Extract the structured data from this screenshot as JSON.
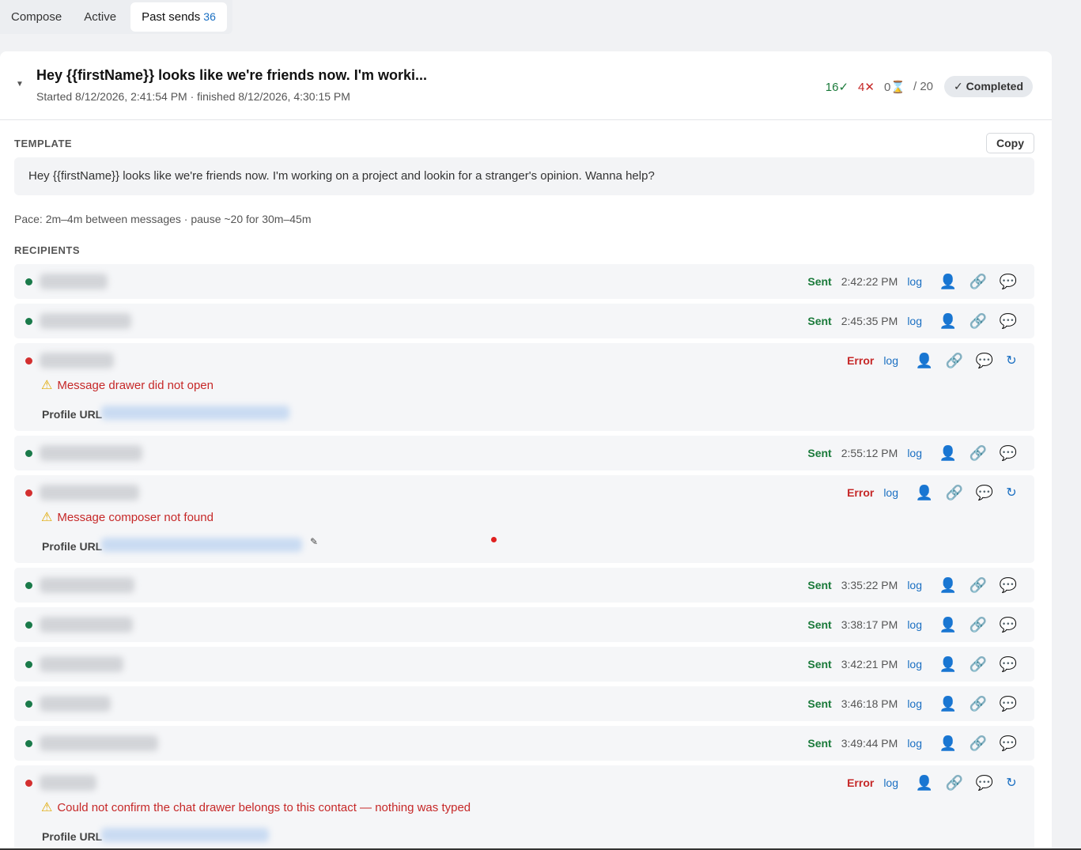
{
  "tabs": [
    {
      "label": "Compose"
    },
    {
      "label": "Active"
    },
    {
      "label": "Past sends",
      "count": "36"
    }
  ],
  "send": {
    "title": "Hey {{firstName}} looks like we're friends now. I'm worki...",
    "subtitle": "Started 8/12/2026, 2:41:54 PM · finished 8/12/2026, 4:30:15 PM",
    "stats": {
      "sent": "16✓",
      "errors": "4✕",
      "pending": "0",
      "total": "/ 20"
    },
    "status_badge": "✓ Completed"
  },
  "template_section": {
    "label": "TEMPLATE",
    "copy_label": "Copy",
    "text": "Hey {{firstName}} looks like we're friends now. I'm working on a project and lookin for a stranger's opinion. Wanna help?"
  },
  "pace": "Pace: 2m–4m between messages · pause ~20 for 30m–45m",
  "recipients_label": "RECIPIENTS",
  "log_label": "log",
  "profile_url_label": "Profile URL",
  "recipients": [
    {
      "status": "Sent",
      "time": "2:42:22 PM"
    },
    {
      "status": "Sent",
      "time": "2:45:35 PM"
    },
    {
      "status": "Error",
      "error": "Message drawer did not open"
    },
    {
      "status": "Sent",
      "time": "2:55:12 PM"
    },
    {
      "status": "Error",
      "error": "Message composer not found"
    },
    {
      "status": "Sent",
      "time": "3:35:22 PM"
    },
    {
      "status": "Sent",
      "time": "3:38:17 PM"
    },
    {
      "status": "Sent",
      "time": "3:42:21 PM"
    },
    {
      "status": "Sent",
      "time": "3:46:18 PM"
    },
    {
      "status": "Sent",
      "time": "3:49:44 PM"
    },
    {
      "status": "Error",
      "error": "Could not confirm the chat drawer belongs to this contact — nothing was typed"
    }
  ],
  "colors": {
    "sent": "#1a7a3a",
    "error": "#c62828",
    "link": "#1a6fc2"
  }
}
